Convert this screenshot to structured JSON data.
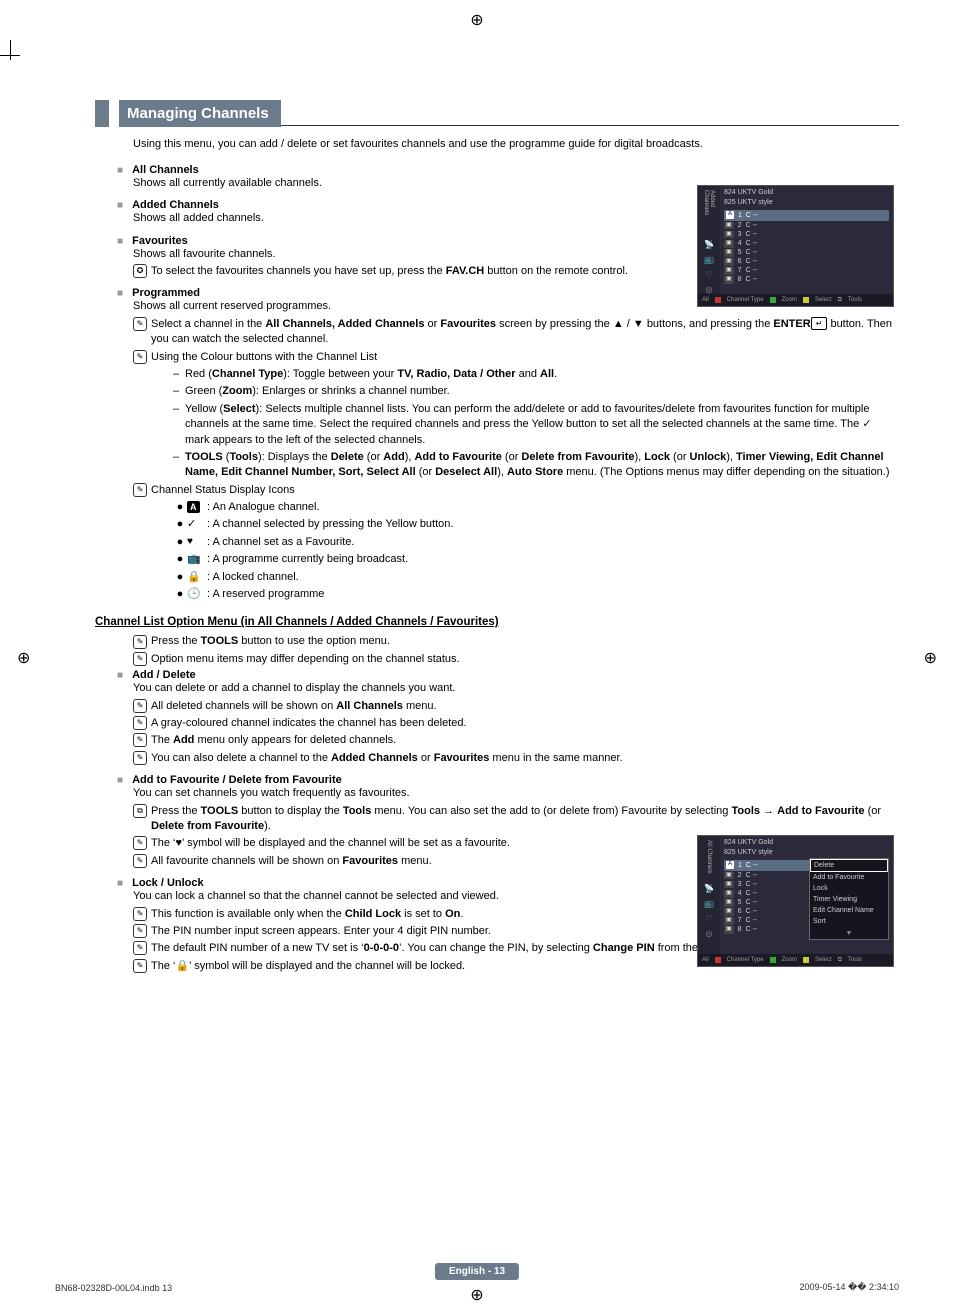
{
  "heading": "Managing Channels",
  "intro": "Using this menu, you can add / delete or set favourites channels and use the programme guide for digital broadcasts.",
  "sections": {
    "all_channels": {
      "title": "All Channels",
      "body": "Shows all currently available channels."
    },
    "added_channels": {
      "title": "Added Channels",
      "body": "Shows all added channels."
    },
    "favourites": {
      "title": "Favourites",
      "body": "Shows all favourite channels.",
      "note_prefix": "To select the favourites channels you have set up, press the ",
      "note_bold": "FAV.CH",
      "note_suffix": " button on the remote control."
    },
    "programmed": {
      "title": "Programmed",
      "body": "Shows all current reserved programmes.",
      "notes": {
        "n1a": "Select a channel in the ",
        "n1b": "All Channels, Added Channels",
        "n1c": " or ",
        "n1d": "Favourites",
        "n1e": " screen by pressing the ▲ / ▼ buttons, and pressing the ",
        "n1f": "ENTER",
        "n1g": " button. Then you can watch the selected channel.",
        "n2": "Using the Colour buttons with the Channel List",
        "d1a": "Red (",
        "d1b": "Channel Type",
        "d1c": "): Toggle between your ",
        "d1d": "TV, Radio, Data / Other",
        "d1e": " and ",
        "d1f": "All",
        "d1g": ".",
        "d2a": "Green (",
        "d2b": "Zoom",
        "d2c": "): Enlarges or shrinks a channel number.",
        "d3a": "Yellow (",
        "d3b": "Select",
        "d3c": "): Selects multiple channel lists. You can perform the add/delete or add to favourites/delete from favourites function for multiple channels at the same time. Select the required channels and press the Yellow button to set all the selected channels at the same time.  The  ✓  mark appears to the left of the selected channels.",
        "d4a": "TOOLS",
        "d4b": " (",
        "d4c": "Tools",
        "d4d": "): Displays the ",
        "d4e": "Delete",
        "d4f": " (or ",
        "d4g": "Add",
        "d4h": "), ",
        "d4i": "Add to Favourite",
        "d4j": " (or ",
        "d4k": "Delete from Favourite",
        "d4l": "), ",
        "d4m": "Lock",
        "d4n": " (or ",
        "d4o": "Unlock",
        "d4p": "), ",
        "d4q": "Timer Viewing, Edit Channel Name, Edit Channel Number, Sort, Select All",
        "d4r": " (or ",
        "d4s": "Deselect All",
        "d4t": "), ",
        "d4u": "Auto Store",
        "d4v": " menu. (The Options menus may differ depending on the situation.)",
        "n3": "Channel Status Display Icons",
        "i1": ": An Analogue channel.",
        "i2": ": A channel selected by pressing the Yellow button.",
        "i3": ": A channel set as a Favourite.",
        "i4": ": A programme currently being broadcast.",
        "i5": ": A locked channel.",
        "i6": ": A reserved programme"
      }
    }
  },
  "sub_head": "Channel List Option Menu (in All Channels / Added Channels / Favourites)",
  "sub_notes": {
    "s1a": "Press the ",
    "s1b": "TOOLS",
    "s1c": " button to use the option menu.",
    "s2": "Option menu items may differ depending on the channel status."
  },
  "options": {
    "add_delete": {
      "title": "Add / Delete",
      "body": "You can delete or add a channel to display the channels you want.",
      "n1a": "All deleted channels will be shown on ",
      "n1b": "All Channels",
      "n1c": " menu.",
      "n2": "A gray-coloured channel indicates the channel has been deleted.",
      "n3a": "The ",
      "n3b": "Add",
      "n3c": " menu only appears for deleted channels.",
      "n4a": "You can also delete a channel to the ",
      "n4b": "Added Channels",
      "n4c": " or ",
      "n4d": "Favourites",
      "n4e": " menu in the same manner."
    },
    "fav": {
      "title": "Add to Favourite / Delete from Favourite",
      "body": "You can set channels you watch frequently as favourites.",
      "t1a": "Press the ",
      "t1b": "TOOLS",
      "t1c": " button to display the ",
      "t1d": "Tools",
      "t1e": " menu. You can also set the add to (or delete from) Favourite by selecting ",
      "t1f": "Tools",
      "t1g": " → ",
      "t1h": "Add to Favourite",
      "t1i": " (or ",
      "t1j": "Delete from Favourite",
      "t1k": ").",
      "n1": "The ‘♥’ symbol will be displayed and the channel will be set as a favourite.",
      "n2a": "All favourite channels will be shown on ",
      "n2b": "Favourites",
      "n2c": " menu."
    },
    "lock": {
      "title": "Lock / Unlock",
      "body": "You can lock a channel so that the channel cannot be selected and viewed.",
      "n1a": "This function is available only when the ",
      "n1b": "Child Lock",
      "n1c": " is set to ",
      "n1d": "On",
      "n1e": ".",
      "n2": "The PIN number input screen appears. Enter your 4 digit PIN number.",
      "n3a": "The default PIN number of a new TV set is ‘",
      "n3b": "0-0-0-0",
      "n3c": "’. You can change the PIN, by selecting ",
      "n3d": "Change PIN",
      "n3e": " from the menu.",
      "n4": "The ‘🔒’ symbol will be displayed and the channel will be locked."
    }
  },
  "osd1": {
    "side_label": "Added Channels",
    "top_rows": [
      "824    UKTV Gold",
      "825    UKTV style"
    ],
    "sel_row": {
      "badge": "A",
      "num": "1",
      "text": "C --"
    },
    "rows": [
      {
        "b": "▣",
        "n": "2",
        "t": "C --"
      },
      {
        "b": "▣",
        "n": "3",
        "t": "C --"
      },
      {
        "b": "▣",
        "n": "4",
        "t": "C --"
      },
      {
        "b": "▣",
        "n": "5",
        "t": "C --"
      },
      {
        "b": "▣",
        "n": "6",
        "t": "C --"
      },
      {
        "b": "▣",
        "n": "7",
        "t": "C --"
      },
      {
        "b": "▣",
        "n": "8",
        "t": "C --"
      }
    ],
    "footer": {
      "all": "All",
      "ct": "Channel Type",
      "zoom": "Zoom",
      "sel": "Select",
      "tools": "Tools"
    }
  },
  "osd2": {
    "side_label": "All Channels",
    "top_rows": [
      "824    UKTV Gold",
      "825    UKTV style"
    ],
    "sel_row": {
      "badge": "A",
      "num": "1",
      "text": "C --"
    },
    "rows": [
      {
        "b": "▣",
        "n": "2",
        "t": "C --"
      },
      {
        "b": "▣",
        "n": "3",
        "t": "C --"
      },
      {
        "b": "▣",
        "n": "4",
        "t": "C --"
      },
      {
        "b": "▣",
        "n": "5",
        "t": "C --"
      },
      {
        "b": "▣",
        "n": "6",
        "t": "C --"
      },
      {
        "b": "▣",
        "n": "7",
        "t": "C --"
      },
      {
        "b": "▣",
        "n": "8",
        "t": "C --"
      }
    ],
    "menu": [
      "Delete",
      "Add to Favourite",
      "Lock",
      "Timer Viewing",
      "Edit Channel Name",
      "Sort",
      "▼"
    ],
    "footer": {
      "all": "All",
      "ct": "Channel Type",
      "zoom": "Zoom",
      "sel": "Select",
      "tools": "Tools"
    }
  },
  "glyphs": {
    "N": "✎",
    "O": "✪",
    "T": "⧉",
    "check": "✓",
    "heart": "♥",
    "bcast": "📺",
    "lock": "🔒",
    "clock": "🕒",
    "enter": "↵"
  },
  "footer": {
    "center": "English - 13",
    "left": "BN68-02328D-00L04.indb   13",
    "right": "2009-05-14   �� 2:34:10"
  }
}
